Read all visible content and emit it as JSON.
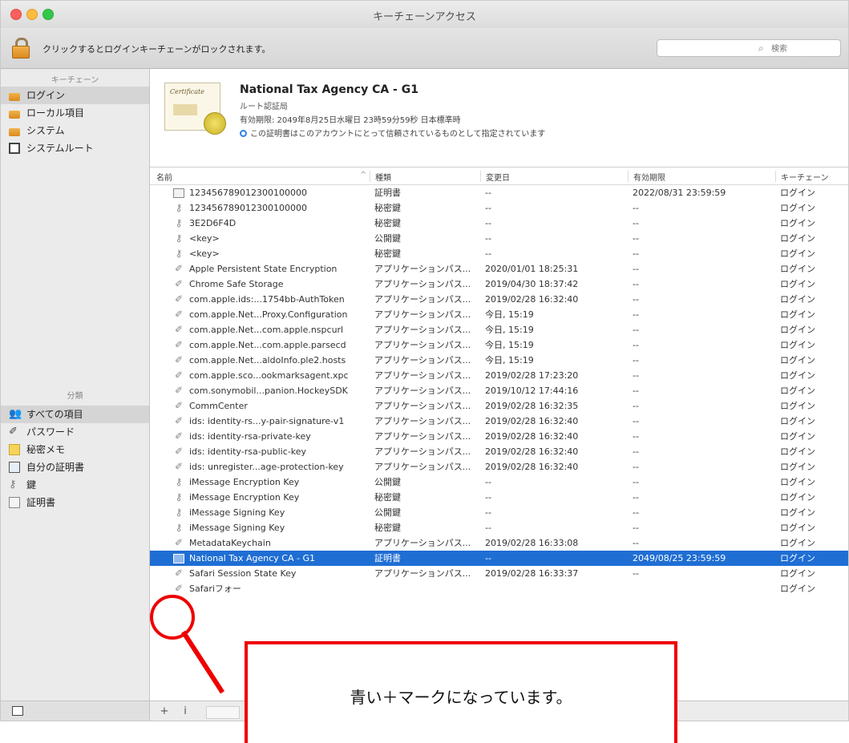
{
  "window": {
    "title": "キーチェーンアクセス"
  },
  "toolbar": {
    "lock_text": "クリックするとログインキーチェーンがロックされます。",
    "search_placeholder": "検索"
  },
  "sidebar": {
    "keychains_header": "キーチェーン",
    "keychains": [
      {
        "label": "ログイン",
        "icon": "lock-open-icon",
        "selected": true
      },
      {
        "label": "ローカル項目",
        "icon": "lock-open-icon"
      },
      {
        "label": "システム",
        "icon": "lock-icon"
      },
      {
        "label": "システムルート",
        "icon": "root-certificate-icon"
      }
    ],
    "categories_header": "分類",
    "categories": [
      {
        "label": "すべての項目",
        "icon": "people-icon",
        "selected": true
      },
      {
        "label": "パスワード",
        "icon": "pen-icon"
      },
      {
        "label": "秘密メモ",
        "icon": "note-icon"
      },
      {
        "label": "自分の証明書",
        "icon": "my-certificate-icon"
      },
      {
        "label": "鍵",
        "icon": "key-icon"
      },
      {
        "label": "証明書",
        "icon": "certificate-icon"
      }
    ]
  },
  "cert": {
    "icon_text": "Certificate",
    "name": "National Tax Agency CA - G1",
    "kind": "ルート認証局",
    "expiry": "有効期限: 2049年8月25日水曜日 23時59分59秒 日本標準時",
    "trust": "この証明書はこのアカウントにとって信頼されているものとして指定されています"
  },
  "columns": {
    "name": "名前",
    "kind": "種類",
    "modified": "変更日",
    "expires": "有効期限",
    "keychain": "キーチェーン"
  },
  "rows": [
    {
      "icon": "cert",
      "name": "123456789012300100000",
      "kind": "証明書",
      "modified": "--",
      "expires": "2022/08/31 23:59:59",
      "keychain": "ログイン"
    },
    {
      "icon": "key",
      "name": "123456789012300100000",
      "kind": "秘密鍵",
      "modified": "--",
      "expires": "--",
      "keychain": "ログイン"
    },
    {
      "icon": "key",
      "name": "3E2D6F4D",
      "kind": "秘密鍵",
      "modified": "--",
      "expires": "--",
      "keychain": "ログイン"
    },
    {
      "icon": "key",
      "name": "<key>",
      "kind": "公開鍵",
      "modified": "--",
      "expires": "--",
      "keychain": "ログイン"
    },
    {
      "icon": "key",
      "name": "<key>",
      "kind": "秘密鍵",
      "modified": "--",
      "expires": "--",
      "keychain": "ログイン"
    },
    {
      "icon": "pen",
      "name": "Apple Persistent State Encryption",
      "kind": "アプリケーションパス...",
      "modified": "2020/01/01 18:25:31",
      "expires": "--",
      "keychain": "ログイン"
    },
    {
      "icon": "pen",
      "name": "Chrome Safe Storage",
      "kind": "アプリケーションパス...",
      "modified": "2019/04/30 18:37:42",
      "expires": "--",
      "keychain": "ログイン"
    },
    {
      "icon": "pen",
      "name": "com.apple.ids:...1754bb-AuthToken",
      "kind": "アプリケーションパス...",
      "modified": "2019/02/28 16:32:40",
      "expires": "--",
      "keychain": "ログイン"
    },
    {
      "icon": "pen",
      "name": "com.apple.Net...Proxy.Configuration",
      "kind": "アプリケーションパス...",
      "modified": "今日, 15:19",
      "expires": "--",
      "keychain": "ログイン"
    },
    {
      "icon": "pen",
      "name": "com.apple.Net...com.apple.nspcurl",
      "kind": "アプリケーションパス...",
      "modified": "今日, 15:19",
      "expires": "--",
      "keychain": "ログイン"
    },
    {
      "icon": "pen",
      "name": "com.apple.Net...com.apple.parsecd",
      "kind": "アプリケーションパス...",
      "modified": "今日, 15:19",
      "expires": "--",
      "keychain": "ログイン"
    },
    {
      "icon": "pen",
      "name": "com.apple.Net...aldoInfo.ple2.hosts",
      "kind": "アプリケーションパス...",
      "modified": "今日, 15:19",
      "expires": "--",
      "keychain": "ログイン"
    },
    {
      "icon": "pen",
      "name": "com.apple.sco...ookmarksagent.xpc",
      "kind": "アプリケーションパス...",
      "modified": "2019/02/28 17:23:20",
      "expires": "--",
      "keychain": "ログイン"
    },
    {
      "icon": "pen",
      "name": "com.sonymobil...panion.HockeySDK",
      "kind": "アプリケーションパス...",
      "modified": "2019/10/12 17:44:16",
      "expires": "--",
      "keychain": "ログイン"
    },
    {
      "icon": "pen",
      "name": "CommCenter",
      "kind": "アプリケーションパス...",
      "modified": "2019/02/28 16:32:35",
      "expires": "--",
      "keychain": "ログイン"
    },
    {
      "icon": "pen",
      "name": "ids: identity-rs...y-pair-signature-v1",
      "kind": "アプリケーションパス...",
      "modified": "2019/02/28 16:32:40",
      "expires": "--",
      "keychain": "ログイン"
    },
    {
      "icon": "pen",
      "name": "ids: identity-rsa-private-key",
      "kind": "アプリケーションパス...",
      "modified": "2019/02/28 16:32:40",
      "expires": "--",
      "keychain": "ログイン"
    },
    {
      "icon": "pen",
      "name": "ids: identity-rsa-public-key",
      "kind": "アプリケーションパス...",
      "modified": "2019/02/28 16:32:40",
      "expires": "--",
      "keychain": "ログイン"
    },
    {
      "icon": "pen",
      "name": "ids: unregister...age-protection-key",
      "kind": "アプリケーションパス...",
      "modified": "2019/02/28 16:32:40",
      "expires": "--",
      "keychain": "ログイン"
    },
    {
      "icon": "key",
      "name": "iMessage Encryption Key",
      "kind": "公開鍵",
      "modified": "--",
      "expires": "--",
      "keychain": "ログイン"
    },
    {
      "icon": "key",
      "name": "iMessage Encryption Key",
      "kind": "秘密鍵",
      "modified": "--",
      "expires": "--",
      "keychain": "ログイン"
    },
    {
      "icon": "key",
      "name": "iMessage Signing Key",
      "kind": "公開鍵",
      "modified": "--",
      "expires": "--",
      "keychain": "ログイン"
    },
    {
      "icon": "key",
      "name": "iMessage Signing Key",
      "kind": "秘密鍵",
      "modified": "--",
      "expires": "--",
      "keychain": "ログイン"
    },
    {
      "icon": "pen",
      "name": "MetadataKeychain",
      "kind": "アプリケーションパス...",
      "modified": "2019/02/28 16:33:08",
      "expires": "--",
      "keychain": "ログイン"
    },
    {
      "icon": "cert",
      "name": "National Tax Agency CA - G1",
      "kind": "証明書",
      "modified": "--",
      "expires": "2049/08/25 23:59:59",
      "keychain": "ログイン",
      "selected": true
    },
    {
      "icon": "pen",
      "name": "Safari Session State Key",
      "kind": "アプリケーションパス...",
      "modified": "2019/02/28 16:33:37",
      "expires": "--",
      "keychain": "ログイン"
    },
    {
      "icon": "pen",
      "name": "Safariフォー",
      "kind": "",
      "modified": "",
      "expires": "",
      "keychain": "ログイン"
    }
  ],
  "bottom": {
    "add": "+",
    "info": "i"
  },
  "annotation": {
    "text": "青い＋マークになっています。",
    "color": "#e00000"
  },
  "colors": {
    "selection": "#1f6ed4",
    "accent": "#2f82e8"
  }
}
